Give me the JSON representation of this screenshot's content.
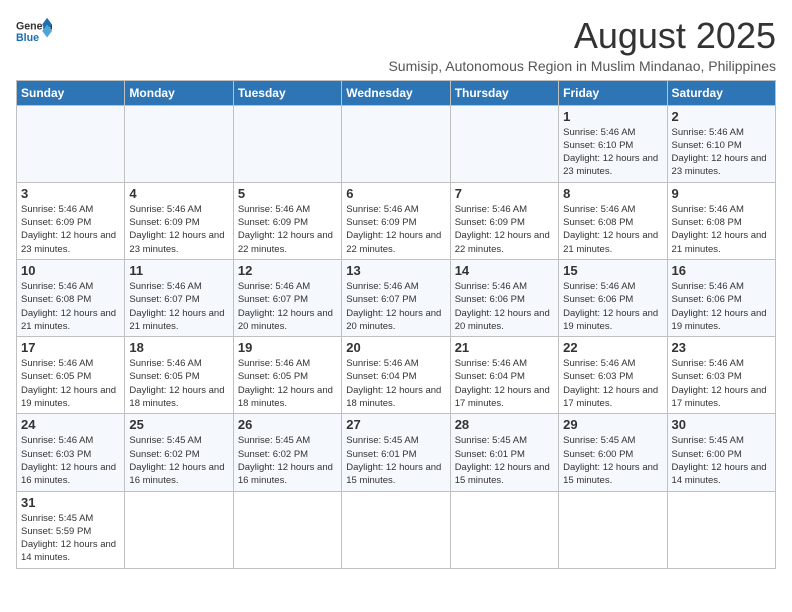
{
  "header": {
    "logo_line1": "General",
    "logo_line2": "Blue",
    "title": "August 2025",
    "subtitle": "Sumisip, Autonomous Region in Muslim Mindanao, Philippines"
  },
  "days_of_week": [
    "Sunday",
    "Monday",
    "Tuesday",
    "Wednesday",
    "Thursday",
    "Friday",
    "Saturday"
  ],
  "weeks": [
    [
      {
        "day": "",
        "info": ""
      },
      {
        "day": "",
        "info": ""
      },
      {
        "day": "",
        "info": ""
      },
      {
        "day": "",
        "info": ""
      },
      {
        "day": "",
        "info": ""
      },
      {
        "day": "1",
        "info": "Sunrise: 5:46 AM\nSunset: 6:10 PM\nDaylight: 12 hours and 23 minutes."
      },
      {
        "day": "2",
        "info": "Sunrise: 5:46 AM\nSunset: 6:10 PM\nDaylight: 12 hours and 23 minutes."
      }
    ],
    [
      {
        "day": "3",
        "info": "Sunrise: 5:46 AM\nSunset: 6:09 PM\nDaylight: 12 hours and 23 minutes."
      },
      {
        "day": "4",
        "info": "Sunrise: 5:46 AM\nSunset: 6:09 PM\nDaylight: 12 hours and 23 minutes."
      },
      {
        "day": "5",
        "info": "Sunrise: 5:46 AM\nSunset: 6:09 PM\nDaylight: 12 hours and 22 minutes."
      },
      {
        "day": "6",
        "info": "Sunrise: 5:46 AM\nSunset: 6:09 PM\nDaylight: 12 hours and 22 minutes."
      },
      {
        "day": "7",
        "info": "Sunrise: 5:46 AM\nSunset: 6:09 PM\nDaylight: 12 hours and 22 minutes."
      },
      {
        "day": "8",
        "info": "Sunrise: 5:46 AM\nSunset: 6:08 PM\nDaylight: 12 hours and 21 minutes."
      },
      {
        "day": "9",
        "info": "Sunrise: 5:46 AM\nSunset: 6:08 PM\nDaylight: 12 hours and 21 minutes."
      }
    ],
    [
      {
        "day": "10",
        "info": "Sunrise: 5:46 AM\nSunset: 6:08 PM\nDaylight: 12 hours and 21 minutes."
      },
      {
        "day": "11",
        "info": "Sunrise: 5:46 AM\nSunset: 6:07 PM\nDaylight: 12 hours and 21 minutes."
      },
      {
        "day": "12",
        "info": "Sunrise: 5:46 AM\nSunset: 6:07 PM\nDaylight: 12 hours and 20 minutes."
      },
      {
        "day": "13",
        "info": "Sunrise: 5:46 AM\nSunset: 6:07 PM\nDaylight: 12 hours and 20 minutes."
      },
      {
        "day": "14",
        "info": "Sunrise: 5:46 AM\nSunset: 6:06 PM\nDaylight: 12 hours and 20 minutes."
      },
      {
        "day": "15",
        "info": "Sunrise: 5:46 AM\nSunset: 6:06 PM\nDaylight: 12 hours and 19 minutes."
      },
      {
        "day": "16",
        "info": "Sunrise: 5:46 AM\nSunset: 6:06 PM\nDaylight: 12 hours and 19 minutes."
      }
    ],
    [
      {
        "day": "17",
        "info": "Sunrise: 5:46 AM\nSunset: 6:05 PM\nDaylight: 12 hours and 19 minutes."
      },
      {
        "day": "18",
        "info": "Sunrise: 5:46 AM\nSunset: 6:05 PM\nDaylight: 12 hours and 18 minutes."
      },
      {
        "day": "19",
        "info": "Sunrise: 5:46 AM\nSunset: 6:05 PM\nDaylight: 12 hours and 18 minutes."
      },
      {
        "day": "20",
        "info": "Sunrise: 5:46 AM\nSunset: 6:04 PM\nDaylight: 12 hours and 18 minutes."
      },
      {
        "day": "21",
        "info": "Sunrise: 5:46 AM\nSunset: 6:04 PM\nDaylight: 12 hours and 17 minutes."
      },
      {
        "day": "22",
        "info": "Sunrise: 5:46 AM\nSunset: 6:03 PM\nDaylight: 12 hours and 17 minutes."
      },
      {
        "day": "23",
        "info": "Sunrise: 5:46 AM\nSunset: 6:03 PM\nDaylight: 12 hours and 17 minutes."
      }
    ],
    [
      {
        "day": "24",
        "info": "Sunrise: 5:46 AM\nSunset: 6:03 PM\nDaylight: 12 hours and 16 minutes."
      },
      {
        "day": "25",
        "info": "Sunrise: 5:45 AM\nSunset: 6:02 PM\nDaylight: 12 hours and 16 minutes."
      },
      {
        "day": "26",
        "info": "Sunrise: 5:45 AM\nSunset: 6:02 PM\nDaylight: 12 hours and 16 minutes."
      },
      {
        "day": "27",
        "info": "Sunrise: 5:45 AM\nSunset: 6:01 PM\nDaylight: 12 hours and 15 minutes."
      },
      {
        "day": "28",
        "info": "Sunrise: 5:45 AM\nSunset: 6:01 PM\nDaylight: 12 hours and 15 minutes."
      },
      {
        "day": "29",
        "info": "Sunrise: 5:45 AM\nSunset: 6:00 PM\nDaylight: 12 hours and 15 minutes."
      },
      {
        "day": "30",
        "info": "Sunrise: 5:45 AM\nSunset: 6:00 PM\nDaylight: 12 hours and 14 minutes."
      }
    ],
    [
      {
        "day": "31",
        "info": "Sunrise: 5:45 AM\nSunset: 5:59 PM\nDaylight: 12 hours and 14 minutes."
      },
      {
        "day": "",
        "info": ""
      },
      {
        "day": "",
        "info": ""
      },
      {
        "day": "",
        "info": ""
      },
      {
        "day": "",
        "info": ""
      },
      {
        "day": "",
        "info": ""
      },
      {
        "day": "",
        "info": ""
      }
    ]
  ]
}
